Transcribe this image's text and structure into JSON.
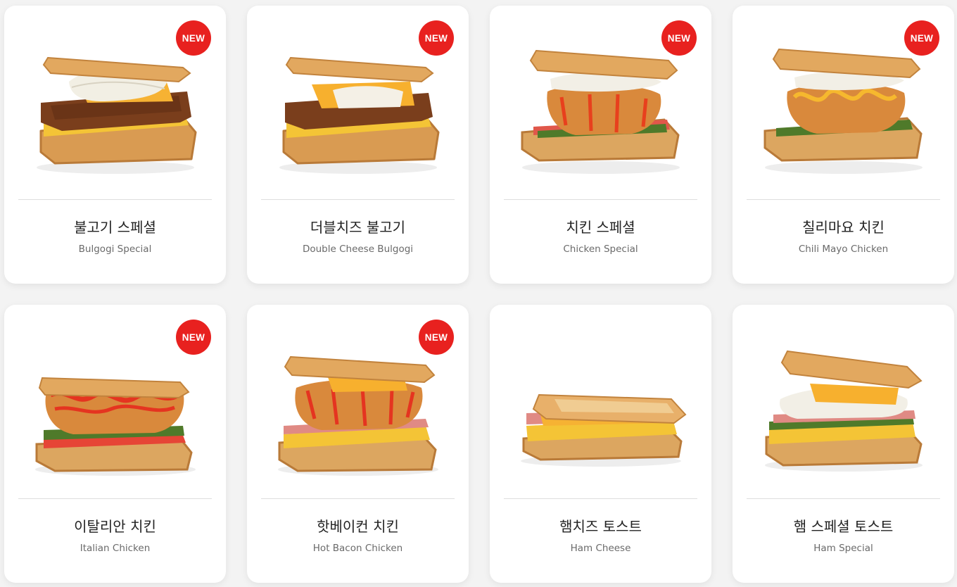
{
  "menu": {
    "items": [
      {
        "name_ko": "불고기 스페셜",
        "name_en": "Bulgogi Special",
        "badge": "NEW",
        "filling": "bulgogi",
        "topping": "cabbage-mayo"
      },
      {
        "name_ko": "더블치즈 불고기",
        "name_en": "Double Cheese Bulgogi",
        "badge": "NEW",
        "filling": "bulgogi",
        "topping": "double-cheese"
      },
      {
        "name_ko": "치킨 스페셜",
        "name_en": "Chicken Special",
        "badge": "NEW",
        "filling": "fried-chicken",
        "topping": "cabbage"
      },
      {
        "name_ko": "칠리마요 치킨",
        "name_en": "Chili Mayo Chicken",
        "badge": "NEW",
        "filling": "fried-chicken",
        "topping": "chili-mayo"
      },
      {
        "name_ko": "이탈리안 치킨",
        "name_en": "Italian Chicken",
        "badge": "NEW",
        "filling": "fried-chicken",
        "topping": "ketchup"
      },
      {
        "name_ko": "핫베이컨 치킨",
        "name_en": "Hot Bacon Chicken",
        "badge": "NEW",
        "filling": "fried-chicken",
        "topping": "cheese-hot-sauce"
      },
      {
        "name_ko": "햄치즈 토스트",
        "name_en": "Ham Cheese",
        "badge": "",
        "filling": "ham-egg",
        "topping": "cheese"
      },
      {
        "name_ko": "햄 스페셜 토스트",
        "name_en": "Ham Special",
        "badge": "",
        "filling": "ham-egg",
        "topping": "cabbage-cheese"
      }
    ]
  },
  "colors": {
    "badge_red": "#e8211f",
    "bread": "#e0a55c",
    "egg": "#f3c238",
    "cheese": "#f8b830",
    "page_bg": "#f3f3f3"
  }
}
